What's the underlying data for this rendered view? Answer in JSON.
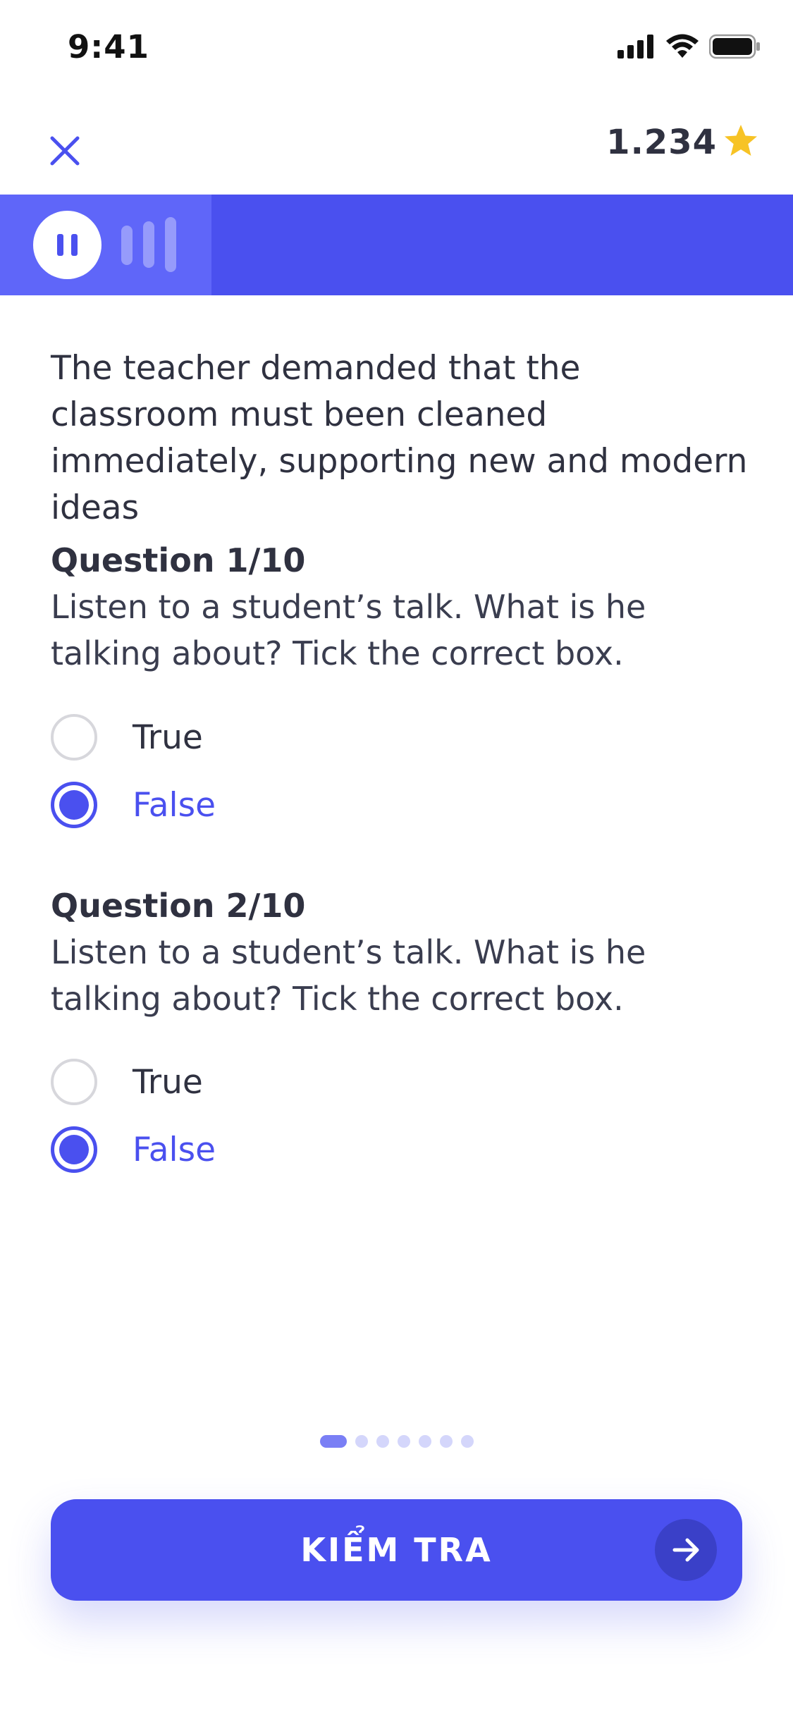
{
  "status_bar": {
    "time": "9:41"
  },
  "header": {
    "score": "1.234"
  },
  "passage": "The teacher demanded that the classroom must been cleaned immediately, supporting new and modern ideas",
  "questions": [
    {
      "title": "Question 1/10",
      "text": "Listen to a student’s talk. What is he talking about? Tick the correct box.",
      "options": [
        {
          "label": "True",
          "selected": false
        },
        {
          "label": "False",
          "selected": true
        }
      ]
    },
    {
      "title": "Question 2/10",
      "text": "Listen to a student’s talk. What is he talking about? Tick the correct box.",
      "options": [
        {
          "label": "True",
          "selected": false
        },
        {
          "label": "False",
          "selected": true
        }
      ]
    }
  ],
  "pager": {
    "count": 7,
    "active": 0
  },
  "footer": {
    "check_label": "KIỂM TRA"
  },
  "colors": {
    "accent": "#4a50ef",
    "star": "#f7c325",
    "text": "#2f3140"
  },
  "icons": {
    "close": "close-icon",
    "star": "star-icon",
    "pause": "pause-icon",
    "waveform": "waveform-icon",
    "arrow": "arrow-right-icon"
  }
}
